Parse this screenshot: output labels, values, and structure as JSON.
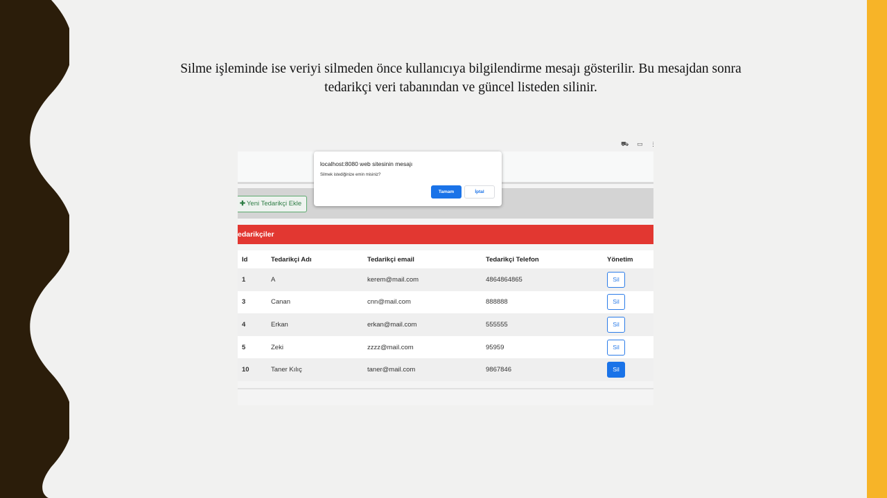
{
  "slide": {
    "caption_line1": "Silme işleminde ise veriyi silmeden önce kullanıcıya bilgilendirme mesajı gösterilir. Bu mesajdan sonra",
    "caption_line2": "tedarikçi veri tabanından ve güncel listeden silinir.",
    "colors": {
      "left_wave": "#2b1d0a",
      "right_bar": "#f7b428",
      "background": "#f1f1f0"
    }
  },
  "page": {
    "add_button_label": "Yeni Tedarikçi Ekle",
    "add_button_icon": "plus-icon",
    "section_title": "edarikçiler",
    "accent_color": "#e23731",
    "table": {
      "headers": [
        "Id",
        "Tedarikçi Adı",
        "Tedarikçi email",
        "Tedarikçi Telefon",
        "Yönetim"
      ],
      "rows": [
        {
          "id": "1",
          "name": "A",
          "email": "kerem@mail.com",
          "phone": "4864864865",
          "action": "Sil"
        },
        {
          "id": "3",
          "name": "Canan",
          "email": "cnn@mail.com",
          "phone": "888888",
          "action": "Sil"
        },
        {
          "id": "4",
          "name": "Erkan",
          "email": "erkan@mail.com",
          "phone": "555555",
          "action": "Sil"
        },
        {
          "id": "5",
          "name": "Zeki",
          "email": "zzzz@mail.com",
          "phone": "95959",
          "action": "Sil"
        },
        {
          "id": "10",
          "name": "Taner Kılıç",
          "email": "taner@mail.com",
          "phone": "9867846",
          "action": "Sil"
        }
      ]
    }
  },
  "dialog": {
    "title": "localhost:8080 web sitesinin mesajı",
    "message": "Silmek istediğinize emin misiniz?",
    "ok_label": "Tamam",
    "cancel_label": "İptal"
  }
}
